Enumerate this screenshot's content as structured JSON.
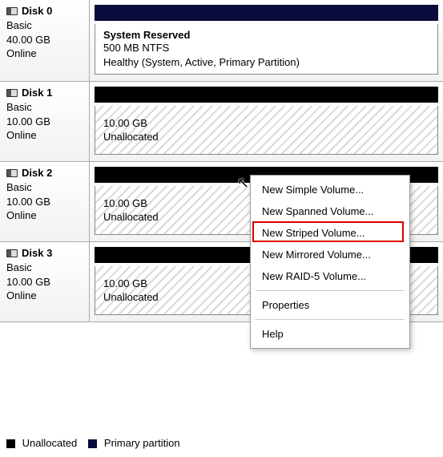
{
  "disks": [
    {
      "name": "Disk 0",
      "type": "Basic",
      "size": "40.00 GB",
      "status": "Online",
      "stripe": "navy",
      "partition": {
        "hatched": false,
        "title": "System Reserved",
        "line1": "500 MB NTFS",
        "line2": "Healthy (System, Active, Primary Partition)"
      }
    },
    {
      "name": "Disk 1",
      "type": "Basic",
      "size": "10.00 GB",
      "status": "Online",
      "stripe": "black",
      "partition": {
        "hatched": true,
        "title": "",
        "line1": "10.00 GB",
        "line2": "Unallocated"
      }
    },
    {
      "name": "Disk 2",
      "type": "Basic",
      "size": "10.00 GB",
      "status": "Online",
      "stripe": "black",
      "partition": {
        "hatched": true,
        "title": "",
        "line1": "10.00 GB",
        "line2": "Unallocated"
      }
    },
    {
      "name": "Disk 3",
      "type": "Basic",
      "size": "10.00 GB",
      "status": "Online",
      "stripe": "black",
      "partition": {
        "hatched": true,
        "title": "",
        "line1": "10.00 GB",
        "line2": "Unallocated"
      }
    }
  ],
  "menu": {
    "new_simple": "New Simple Volume...",
    "new_spanned": "New Spanned Volume...",
    "new_striped": "New Striped Volume...",
    "new_mirrored": "New Mirrored Volume...",
    "new_raid5": "New RAID-5 Volume...",
    "properties": "Properties",
    "help": "Help"
  },
  "legend": {
    "unallocated": "Unallocated",
    "primary": "Primary partition"
  }
}
